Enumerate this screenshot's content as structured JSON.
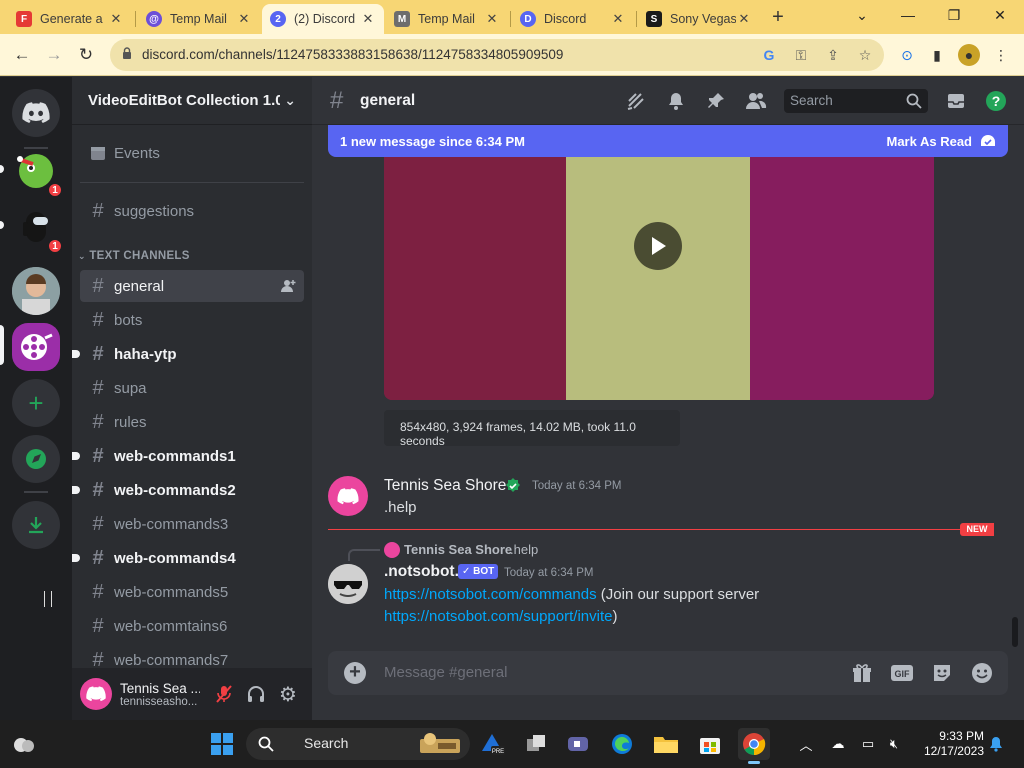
{
  "browser": {
    "tabs": [
      {
        "title": "Generate a",
        "favicon": "F",
        "favicon_color": "#e53935"
      },
      {
        "title": "Temp Mail",
        "favicon": "@",
        "favicon_color": "#6c4fd8"
      },
      {
        "title": "(2) Discord",
        "favicon": "2",
        "favicon_color": "#5865f2"
      },
      {
        "title": "Temp Mail",
        "favicon": "M",
        "favicon_color": "#6d6d6d"
      },
      {
        "title": "Discord",
        "favicon": "D",
        "favicon_color": "#5865f2"
      },
      {
        "title": "Sony Vegas",
        "favicon": "S",
        "favicon_color": "#1a1a1a"
      }
    ],
    "url": "discord.com/channels/1124758333883158638/1124758334805909509"
  },
  "server": {
    "name": "VideoEditBot Collection 1.0",
    "events_label": "Events",
    "suggestions_label": "suggestions",
    "category": "TEXT CHANNELS",
    "channels": [
      {
        "name": "general"
      },
      {
        "name": "bots"
      },
      {
        "name": "haha-ytp"
      },
      {
        "name": "supa"
      },
      {
        "name": "rules"
      },
      {
        "name": "web-commands1"
      },
      {
        "name": "web-commands2"
      },
      {
        "name": "web-commands3"
      },
      {
        "name": "web-commands4"
      },
      {
        "name": "web-commands5"
      },
      {
        "name": "web-commtains6"
      },
      {
        "name": "web-commands7"
      }
    ]
  },
  "guilds": {
    "badges": [
      "1",
      "1"
    ]
  },
  "user": {
    "name": "Tennis Sea ...",
    "tag": "tennisseasho..."
  },
  "chat": {
    "channel": "general",
    "search_placeholder": "Search",
    "banner_text": "1 new message since 6:34 PM",
    "banner_action": "Mark As Read",
    "video_info": "854x480, 3,924 frames, 14.02 MB, took 11.0 seconds",
    "messages": [
      {
        "author": "Tennis Sea Shore",
        "time": "Today at 6:34 PM",
        "text": ".help"
      },
      {
        "reply_author": "Tennis Sea Shore",
        "reply_text": ".help",
        "author": ".notsobot.",
        "bot_tag": "BOT",
        "time": "Today at 6:34 PM",
        "link1": "https://notsobot.com/commands",
        "link1_suffix": "(Join our support server",
        "link2": "https://notsobot.com/support/invite",
        "link2_suffix": ")"
      }
    ],
    "new_tag": "NEW",
    "composer_placeholder": "Message #general"
  },
  "taskbar": {
    "search_label": "Search",
    "time": "9:33 PM",
    "date": "12/17/2023"
  },
  "colors": {
    "blurple": "#5865f2",
    "green": "#23a559",
    "red": "#f23f43",
    "link": "#00a8fc"
  }
}
